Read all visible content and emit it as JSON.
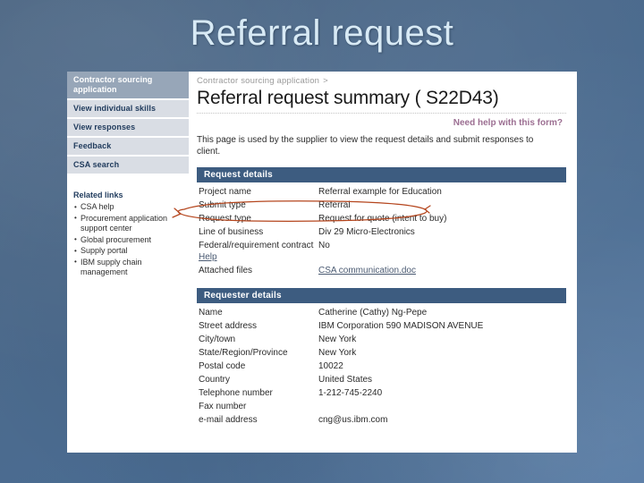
{
  "slide": {
    "title": "Referral request"
  },
  "sidebar": {
    "nav_items": [
      {
        "label": "Contractor sourcing application",
        "active": true
      },
      {
        "label": "View individual skills",
        "active": false
      },
      {
        "label": "View responses",
        "active": false
      },
      {
        "label": "Feedback",
        "active": false
      },
      {
        "label": "CSA search",
        "active": false
      }
    ],
    "related_links_title": "Related links",
    "related_links": [
      "CSA help",
      "Procurement application support center",
      "Global procurement",
      "Supply portal",
      "IBM supply chain management"
    ]
  },
  "header": {
    "breadcrumb": "Contractor sourcing application",
    "breadcrumb_separator": ">",
    "page_title": "Referral request summary ( S22D43)",
    "help_link": "Need help with this form?",
    "intro": "This page is used by the supplier to view the request details and submit responses to client."
  },
  "request_details": {
    "section_title": "Request details",
    "rows": [
      {
        "label": "Project name",
        "value": "Referral example for Education"
      },
      {
        "label": "Submit type",
        "value": "Referral"
      },
      {
        "label": "Request type",
        "value": "Request for quote (intent to buy)"
      },
      {
        "label": "Line of business",
        "value": "Div 29 Micro-Electronics"
      },
      {
        "label": "Federal/requirement contract",
        "label_link": "Help",
        "value": "No"
      },
      {
        "label": "Attached files",
        "value": "CSA communication.doc",
        "value_is_link": true
      }
    ]
  },
  "requester_details": {
    "section_title": "Requester details",
    "rows": [
      {
        "label": "Name",
        "value": "Catherine (Cathy) Ng-Pepe"
      },
      {
        "label": "Street address",
        "value": "IBM Corporation 590 MADISON AVENUE"
      },
      {
        "label": "City/town",
        "value": "New York"
      },
      {
        "label": "State/Region/Province",
        "value": "New York"
      },
      {
        "label": "Postal code",
        "value": "10022"
      },
      {
        "label": "Country",
        "value": "United States"
      },
      {
        "label": "Telephone number",
        "value": "1-212-745-2240"
      },
      {
        "label": "Fax number",
        "value": ""
      },
      {
        "label": "e-mail address",
        "value": "cng@us.ibm.com"
      }
    ]
  },
  "annotation": {
    "shape": "hand-drawn-ellipse",
    "color": "#b5461e",
    "targets": "Submit type / Referral"
  },
  "colors": {
    "slide_background": "#4d6a8c",
    "slide_title": "#d8eaf5",
    "section_bar": "#3d5c80",
    "nav_active": "#97a6b8",
    "nav_inactive": "#d9dde4",
    "help_link": "#9c6f92",
    "link": "#4a5a72",
    "annotation": "#b5461e"
  }
}
